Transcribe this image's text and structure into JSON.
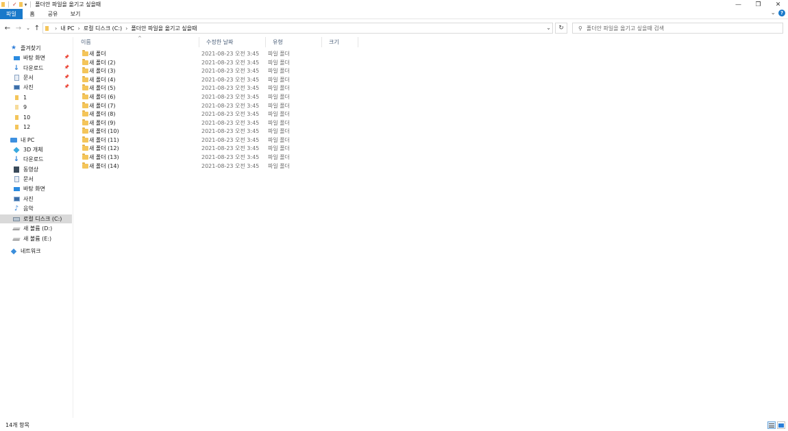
{
  "window": {
    "title": "폴더안 파일을 옮기고 싶을때",
    "controls": [
      "minimize-icon",
      "restore-icon",
      "close-icon"
    ]
  },
  "ribbon": {
    "tabs": [
      "파일",
      "홈",
      "공유",
      "보기"
    ]
  },
  "nav": {
    "breadcrumb": [
      "내 PC",
      "로컬 디스크 (C:)",
      "폴더안 파일을 옮기고 싶을때"
    ],
    "search_placeholder": "폴더안 파일을 옮기고 싶을때 검색"
  },
  "sidebar": {
    "items": [
      {
        "label": "즐겨찾기",
        "icon": "star-icon"
      },
      {
        "label": "바탕 화면",
        "icon": "desktop-icon",
        "pinned": true
      },
      {
        "label": "다운로드",
        "icon": "download-icon",
        "pinned": true
      },
      {
        "label": "문서",
        "icon": "document-icon",
        "pinned": true
      },
      {
        "label": "사진",
        "icon": "picture-icon",
        "pinned": true
      },
      {
        "label": "1",
        "icon": "folder-icon"
      },
      {
        "label": "9",
        "icon": "folder-icon"
      },
      {
        "label": "10",
        "icon": "folder-icon"
      },
      {
        "label": "12",
        "icon": "folder-icon"
      },
      {
        "label": "내 PC",
        "icon": "pc-icon"
      },
      {
        "label": "3D 개체",
        "icon": "3d-objects-icon"
      },
      {
        "label": "다운로드",
        "icon": "download-icon"
      },
      {
        "label": "동영상",
        "icon": "video-icon"
      },
      {
        "label": "문서",
        "icon": "document-icon"
      },
      {
        "label": "바탕 화면",
        "icon": "desktop-icon"
      },
      {
        "label": "사진",
        "icon": "picture-icon"
      },
      {
        "label": "음악",
        "icon": "music-icon"
      },
      {
        "label": "로컬 디스크 (C:)",
        "icon": "drive-icon",
        "selected": true
      },
      {
        "label": "새 볼륨 (D:)",
        "icon": "drive-icon"
      },
      {
        "label": "새 볼륨 (E:)",
        "icon": "drive-icon"
      },
      {
        "label": "네트워크",
        "icon": "network-icon"
      }
    ]
  },
  "columns": [
    "이름",
    "수정한 날짜",
    "유형",
    "크기"
  ],
  "files": [
    {
      "name": "새 폴더",
      "date": "2021-08-23 오전 3:45",
      "type": "파일 폴더"
    },
    {
      "name": "새 폴더 (2)",
      "date": "2021-08-23 오전 3:45",
      "type": "파일 폴더"
    },
    {
      "name": "새 폴더 (3)",
      "date": "2021-08-23 오전 3:45",
      "type": "파일 폴더"
    },
    {
      "name": "새 폴더 (4)",
      "date": "2021-08-23 오전 3:45",
      "type": "파일 폴더"
    },
    {
      "name": "새 폴더 (5)",
      "date": "2021-08-23 오전 3:45",
      "type": "파일 폴더"
    },
    {
      "name": "새 폴더 (6)",
      "date": "2021-08-23 오전 3:45",
      "type": "파일 폴더"
    },
    {
      "name": "새 폴더 (7)",
      "date": "2021-08-23 오전 3:45",
      "type": "파일 폴더"
    },
    {
      "name": "새 폴더 (8)",
      "date": "2021-08-23 오전 3:45",
      "type": "파일 폴더"
    },
    {
      "name": "새 폴더 (9)",
      "date": "2021-08-23 오전 3:45",
      "type": "파일 폴더"
    },
    {
      "name": "새 폴더 (10)",
      "date": "2021-08-23 오전 3:45",
      "type": "파일 폴더"
    },
    {
      "name": "새 폴더 (11)",
      "date": "2021-08-23 오전 3:45",
      "type": "파일 폴더"
    },
    {
      "name": "새 폴더 (12)",
      "date": "2021-08-23 오전 3:45",
      "type": "파일 폴더"
    },
    {
      "name": "새 폴더 (13)",
      "date": "2021-08-23 오전 3:45",
      "type": "파일 폴더"
    },
    {
      "name": "새 폴더 (14)",
      "date": "2021-08-23 오전 3:45",
      "type": "파일 폴더"
    }
  ],
  "status": {
    "item_count": "14개 항목"
  },
  "colors": {
    "accent": "#1979ca",
    "folder": "#f4c55a",
    "selected_bg": "#d9d9d9"
  }
}
